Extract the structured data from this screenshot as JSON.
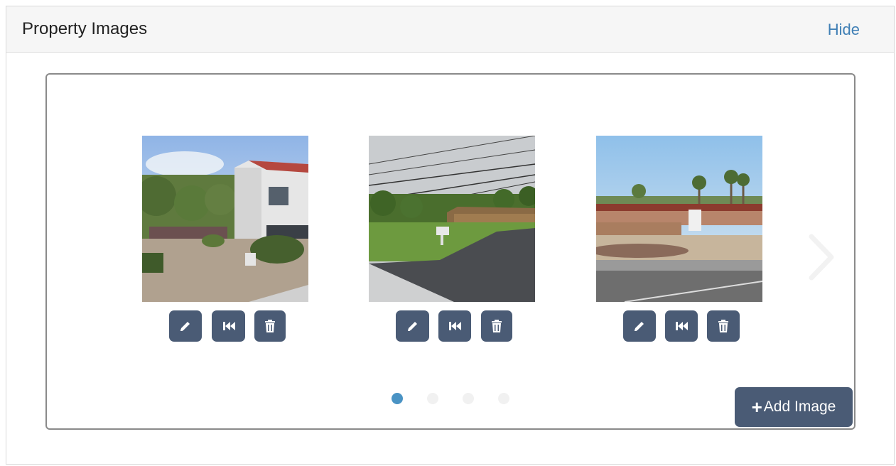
{
  "panel": {
    "title": "Property Images",
    "hide_label": "Hide"
  },
  "carousel": {
    "images": [
      {
        "actions": [
          "edit-icon",
          "first-icon",
          "trash-icon"
        ]
      },
      {
        "actions": [
          "edit-icon",
          "first-icon",
          "trash-icon"
        ]
      },
      {
        "actions": [
          "edit-icon",
          "first-icon",
          "trash-icon"
        ]
      }
    ],
    "page_count": 4,
    "active_page": 1,
    "add_image_label": "Add Image"
  },
  "colors": {
    "button_bg": "#4a5b75",
    "link": "#3f7fb5",
    "dot_active": "#4a93c4",
    "dot_inactive": "#f1f1f1"
  }
}
